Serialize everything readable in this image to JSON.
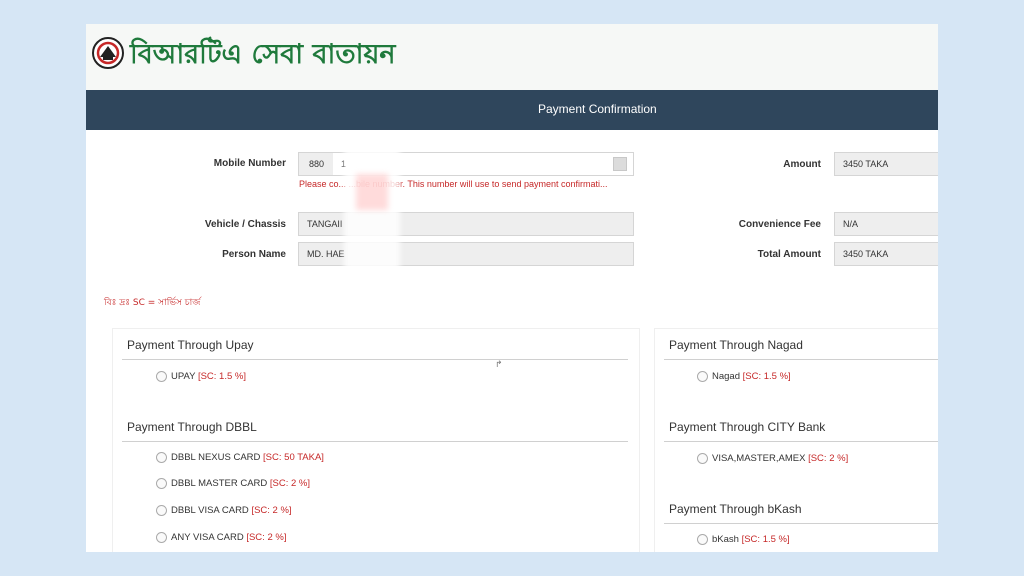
{
  "header": {
    "brand_title": "বিআরটিএ সেবা বাতায়ন",
    "page_title": "Payment Confirmation"
  },
  "form": {
    "mobile": {
      "label": "Mobile Number",
      "country_code": "880",
      "value": "1",
      "warning": "Please co... ...bile number. This number will use to send payment confirmati..."
    },
    "vehicle": {
      "label": "Vehicle / Chassis",
      "value": "TANGAII"
    },
    "person": {
      "label": "Person Name",
      "value": "MD. HAE"
    },
    "amount": {
      "label": "Amount",
      "value": "3450 TAKA"
    },
    "fee": {
      "label": "Convenience Fee",
      "value": "N/A"
    },
    "total": {
      "label": "Total Amount",
      "value": "3450 TAKA"
    }
  },
  "note": "বিঃ দ্রঃ SC = সার্ভিস চার্জ",
  "payments": {
    "upay": {
      "title": "Payment Through Upay",
      "options": [
        {
          "name": "UPAY",
          "sc": "[SC: 1.5 %]"
        }
      ]
    },
    "dbbl": {
      "title": "Payment Through DBBL",
      "options": [
        {
          "name": "DBBL NEXUS CARD",
          "sc": "[SC: 50 TAKA]"
        },
        {
          "name": "DBBL MASTER CARD",
          "sc": "[SC: 2 %]"
        },
        {
          "name": "DBBL VISA CARD",
          "sc": "[SC: 2 %]"
        },
        {
          "name": "ANY VISA CARD",
          "sc": "[SC: 2 %]"
        }
      ]
    },
    "nagad": {
      "title": "Payment Through Nagad",
      "options": [
        {
          "name": "Nagad",
          "sc": "[SC: 1.5 %]"
        }
      ]
    },
    "city": {
      "title": "Payment Through CITY Bank",
      "options": [
        {
          "name": "VISA,MASTER,AMEX",
          "sc": "[SC: 2 %]"
        }
      ]
    },
    "bkash": {
      "title": "Payment Through bKash",
      "options": [
        {
          "name": "bKash",
          "sc": "[SC: 1.5 %]"
        }
      ]
    }
  },
  "colors": {
    "header_bar": "#2f465c",
    "brand_green": "#1f7a3c",
    "service_charge": "#c62828",
    "background": "#d6e6f5"
  }
}
